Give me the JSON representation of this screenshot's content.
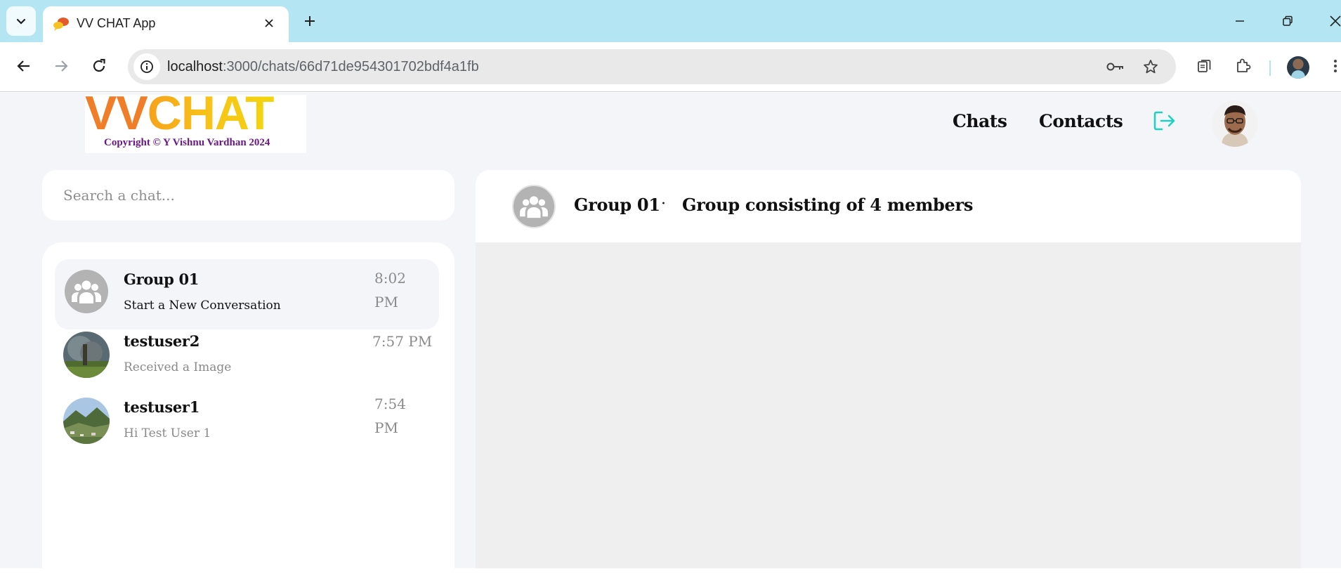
{
  "browser": {
    "tab_title": "VV CHAT App",
    "url_host": "localhost",
    "url_path": ":3000/chats/66d71de954301702bdf4a1fb",
    "icons": [
      "tab-list-icon",
      "favicon",
      "close-icon",
      "plus-icon",
      "minimize-icon",
      "restore-icon",
      "close-window-icon",
      "back-icon",
      "forward-icon",
      "reload-icon",
      "site-info-icon",
      "key-icon",
      "star-icon",
      "reading-list-icon",
      "extensions-icon",
      "profile-avatar",
      "more-icon"
    ]
  },
  "logo": {
    "vv": "VV",
    "chat": "CHAT",
    "copyright": "Copyright © Y Vishnu Vardhan 2024"
  },
  "nav": {
    "chats": "Chats",
    "contacts": "Contacts",
    "logout_icon": "logout-icon",
    "accent_color": "#1fd1c1"
  },
  "search": {
    "placeholder": "Search a chat..."
  },
  "chats": [
    {
      "name": "Group 01",
      "message": "Start a New Conversation",
      "time": "8:02 PM",
      "avatar": "group-icon",
      "active": true
    },
    {
      "name": "testuser2",
      "message": "Received a Image",
      "time": "7:57 PM",
      "avatar": "photo"
    },
    {
      "name": "testuser1",
      "message": "Hi Test User 1",
      "time": "7:54 PM",
      "avatar": "photo"
    }
  ],
  "conversation": {
    "title": "Group 01",
    "separator": "·",
    "description": "Group consisting of 4 members"
  }
}
